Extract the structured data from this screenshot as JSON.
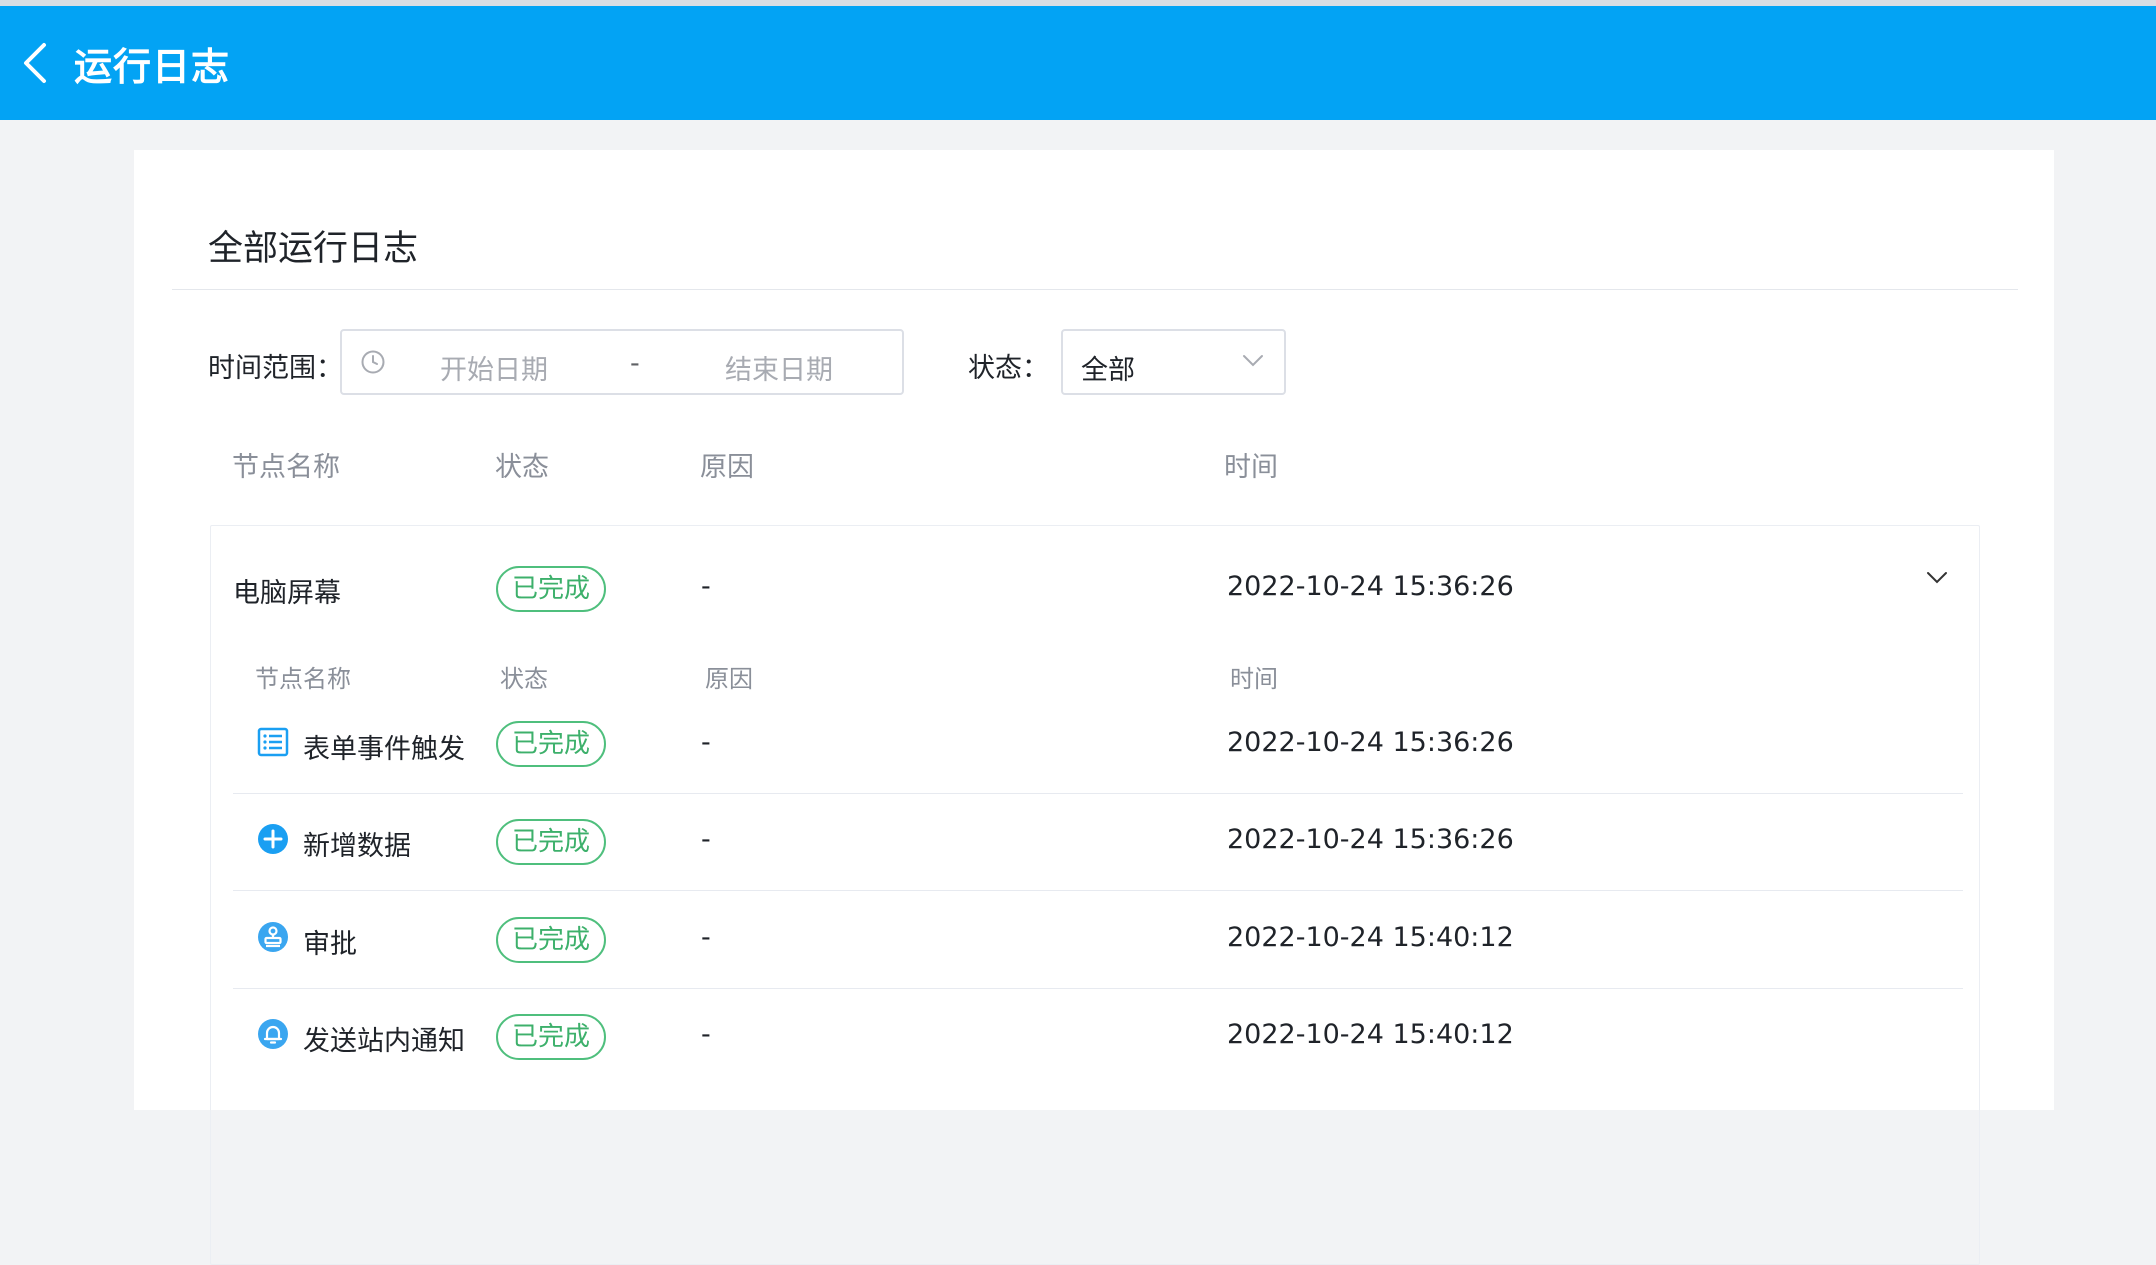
{
  "header": {
    "title": "运行日志"
  },
  "card": {
    "title": "全部运行日志",
    "filters": {
      "time_label": "时间范围：",
      "start_placeholder": "开始日期",
      "separator": "-",
      "end_placeholder": "结束日期",
      "status_label": "状态：",
      "status_value": "全部"
    },
    "columns": [
      "节点名称",
      "状态",
      "原因",
      "时间"
    ],
    "group": {
      "name": "电脑屏幕",
      "status": "已完成",
      "reason": "-",
      "time": "2022-10-24 15:36:26",
      "sub_columns": [
        "节点名称",
        "状态",
        "原因",
        "时间"
      ],
      "rows": [
        {
          "icon": "form-icon",
          "name": "表单事件触发",
          "status": "已完成",
          "reason": "-",
          "time": "2022-10-24 15:36:26"
        },
        {
          "icon": "add-circle-icon",
          "name": "新增数据",
          "status": "已完成",
          "reason": "-",
          "time": "2022-10-24 15:36:26"
        },
        {
          "icon": "stamp-icon",
          "name": "审批",
          "status": "已完成",
          "reason": "-",
          "time": "2022-10-24 15:40:12"
        },
        {
          "icon": "bell-icon",
          "name": "发送站内通知",
          "status": "已完成",
          "reason": "-",
          "time": "2022-10-24 15:40:12"
        }
      ]
    }
  },
  "colors": {
    "header_bg": "#03a3f4",
    "success": "#3db06b",
    "icon_blue": "#1a9ff2"
  }
}
